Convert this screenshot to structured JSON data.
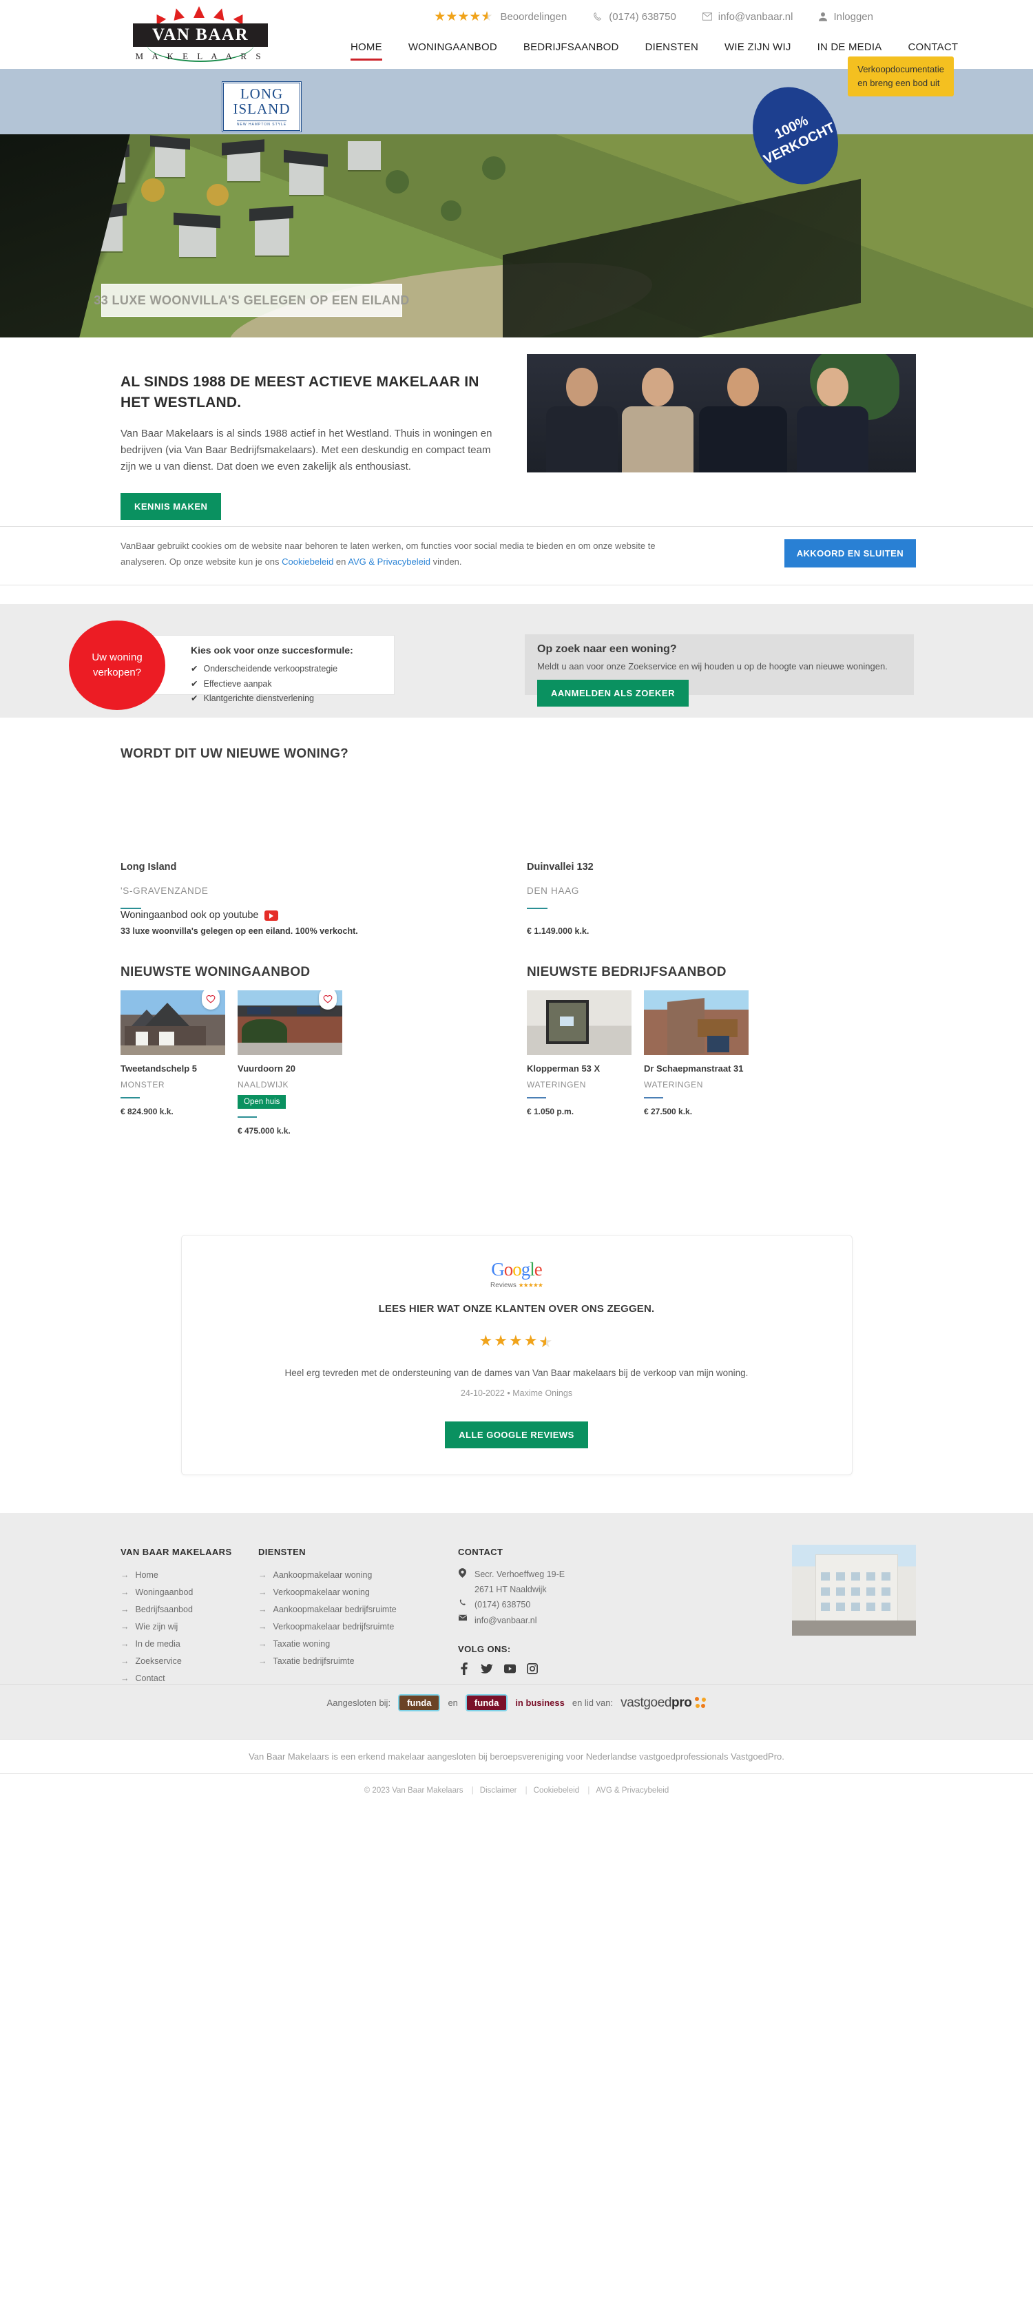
{
  "topbar": {
    "rating_label": "Beoordelingen",
    "rating_value": 4.5,
    "phone": "(0174) 638750",
    "email": "info@vanbaar.nl",
    "login": "Inloggen",
    "phone_icon": "phone-icon",
    "email_icon": "envelope-icon",
    "user_icon": "user-icon"
  },
  "logo": {
    "line1": "VAN BAAR",
    "line2": "M A K E L A A R S"
  },
  "nav": {
    "items": [
      {
        "label": "HOME",
        "active": true
      },
      {
        "label": "WONINGAANBOD",
        "active": false
      },
      {
        "label": "BEDRIJFSAANBOD",
        "active": false
      },
      {
        "label": "DIENSTEN",
        "active": false
      },
      {
        "label": "WIE ZIJN WIJ",
        "active": false
      },
      {
        "label": "IN DE MEDIA",
        "active": false
      },
      {
        "label": "CONTACT",
        "active": false
      }
    ]
  },
  "hero": {
    "project_logo_line1": "LONG",
    "project_logo_line2": "ISLAND",
    "project_logo_sub": "NEW HAMPTON STYLE",
    "badge": "100% VERKOCHT",
    "caption": "33 LUXE WOONVILLA'S GELEGEN OP EEN EILAND"
  },
  "intro": {
    "heading": "AL SINDS 1988 DE MEEST ACTIEVE MAKELAAR IN HET WESTLAND.",
    "body": "Van Baar Makelaars is al sinds 1988 actief in het Westland. Thuis in woningen en bedrijven (via Van Baar Bedrijfsmakelaars). Met een deskundig en compact team zijn we u van dienst. Dat doen we even zakelijk als enthousiast.",
    "button": "KENNIS MAKEN"
  },
  "cookiebar": {
    "text_1": "VanBaar gebruikt cookies om de website naar behoren te laten werken, om functies voor social media te bieden en om onze website te analyseren. Op onze website kun je ons ",
    "link_1": "Cookiebeleid",
    "text_2": " en ",
    "link_2": "AVG & Privacybeleid",
    "text_3": " vinden.",
    "accept_button": "AKKOORD EN SLUITEN"
  },
  "float_cta": {
    "line1": "Verkoopdocumentatie",
    "line2": "en breng een bod uit"
  },
  "sell": {
    "badge_line1": "Uw woning",
    "badge_line2": "verkopen?",
    "heading": "Kies ook voor onze succesformule:",
    "items": [
      "Onderscheidende verkoopstrategie",
      "Effectieve aanpak",
      "Klantgerichte dienstverlening"
    ],
    "tick": "✔"
  },
  "seek": {
    "heading": "Op zoek naar een woning?",
    "body": "Meldt u aan voor onze Zoekservice en wij houden u op de hoogte van nieuwe woningen.",
    "button": "AANMELDEN ALS ZOEKER"
  },
  "featured": {
    "heading": "WORDT DIT UW NIEUWE WONING?",
    "items": [
      {
        "title": "Long Island",
        "city": "'S-GRAVENZANDE",
        "price": "33 luxe woonvilla's gelegen op een eiland. 100% verkocht."
      },
      {
        "title": "Duinvallei 132",
        "city": "DEN HAAG",
        "price": "€ 1.149.000 k.k."
      }
    ],
    "youtube_label": "Woningaanbod ook op youtube",
    "youtube_icon": "youtube-icon"
  },
  "listings": {
    "woning": {
      "heading": "NIEUWSTE WONINGAANBOD",
      "cards": [
        {
          "title": "Tweetandschelp 5",
          "city": "MONSTER",
          "price": "€ 824.900 k.k.",
          "tag": "",
          "fav_icon": "heart-icon"
        },
        {
          "title": "Vuurdoorn 20",
          "city": "NAALDWIJK",
          "price": "€ 475.000 k.k.",
          "tag": "Open huis",
          "fav_icon": "heart-icon"
        }
      ]
    },
    "bedrijf": {
      "heading": "NIEUWSTE BEDRIJFSAANBOD",
      "cards": [
        {
          "title": "Klopperman 53 X",
          "city": "WATERINGEN",
          "price": "€ 1.050 p.m.",
          "tag": ""
        },
        {
          "title": "Dr Schaepmanstraat 31",
          "city": "WATERINGEN",
          "price": "€ 27.500 k.k.",
          "tag": ""
        }
      ]
    }
  },
  "reviews": {
    "brand": "Google",
    "brand_sub": "Reviews",
    "heading": "LEES HIER WAT ONZE KLANTEN OVER ONS ZEGGEN.",
    "rating_value": 4.5,
    "quote": "Heel erg tevreden met de ondersteuning van de dames van Van Baar makelaars bij de verkoop van mijn woning.",
    "date": "24-10-2022",
    "author": "Maxime Onings",
    "meta_sep": "•",
    "button": "ALLE GOOGLE REVIEWS"
  },
  "footer": {
    "col1": {
      "heading": "VAN BAAR MAKELAARS",
      "items": [
        "Home",
        "Woningaanbod",
        "Bedrijfsaanbod",
        "Wie zijn wij",
        "In de media",
        "Zoekservice",
        "Contact"
      ]
    },
    "col2": {
      "heading": "DIENSTEN",
      "items": [
        "Aankoopmakelaar woning",
        "Verkoopmakelaar woning",
        "Aankoopmakelaar bedrijfsruimte",
        "Verkoopmakelaar bedrijfsruimte",
        "Taxatie woning",
        "Taxatie bedrijfsruimte"
      ]
    },
    "col3": {
      "heading": "CONTACT",
      "address_line1": "Secr. Verhoeffweg 19-E",
      "address_line2": "2671 HT Naaldwijk",
      "phone": "(0174) 638750",
      "email": "info@vanbaar.nl",
      "follow_heading": "VOLG ONS:",
      "socials": [
        "facebook-icon",
        "twitter-icon",
        "youtube-icon",
        "instagram-icon"
      ],
      "pin_icon": "map-pin-icon",
      "phone_icon": "phone-icon",
      "mail_icon": "envelope-icon"
    },
    "partners": {
      "prefix": "Aangesloten bij:",
      "funda": "funda",
      "and": "en",
      "funda2": "funda",
      "in_business": "in business",
      "member_prefix": "en lid van:",
      "vastgoedpro_light": "vastgoed",
      "vastgoedpro_bold": "pro"
    },
    "disclaimer": "Van Baar Makelaars is een erkend makelaar aangesloten bij beroepsvereniging voor Nederlandse vastgoedprofessionals VastgoedPro.",
    "copyright": "© 2023 Van Baar Makelaars",
    "links": [
      "Disclaimer",
      "Cookiebeleid",
      "AVG & Privacybeleid"
    ]
  },
  "arrow": "→"
}
